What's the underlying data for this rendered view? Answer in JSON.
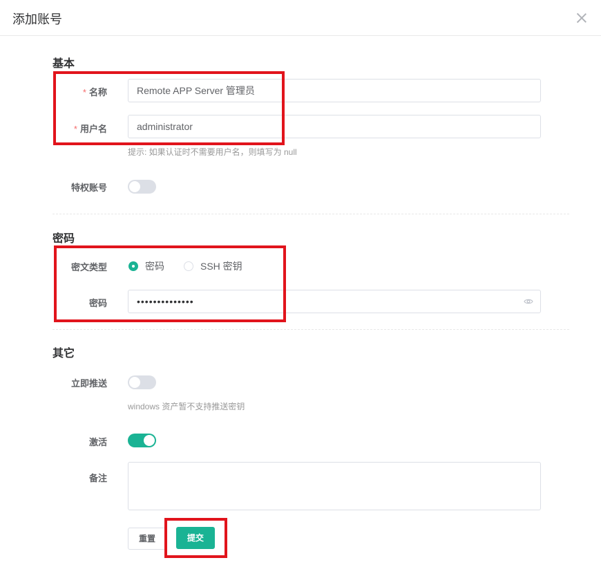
{
  "dialog": {
    "title": "添加账号"
  },
  "sections": {
    "basic": "基本",
    "password": "密码",
    "other": "其它"
  },
  "fields": {
    "name": {
      "label": "名称",
      "required_mark": "*",
      "value": "Remote APP Server 管理员"
    },
    "username": {
      "label": "用户名",
      "required_mark": "*",
      "value": "administrator",
      "hint": "提示: 如果认证时不需要用户名，则填写为 null"
    },
    "privileged": {
      "label": "特权账号",
      "on": false
    },
    "secret_type": {
      "label": "密文类型",
      "options": [
        "密码",
        "SSH 密钥"
      ],
      "selected": "密码"
    },
    "secret": {
      "label": "密码",
      "value": "••••••••••••••"
    },
    "push_now": {
      "label": "立即推送",
      "on": false,
      "hint": "windows 资产暂不支持推送密钥"
    },
    "active": {
      "label": "激活",
      "on": true
    },
    "comment": {
      "label": "备注",
      "value": ""
    }
  },
  "buttons": {
    "reset": "重置",
    "submit": "提交"
  },
  "colors": {
    "accent": "#1ab394",
    "required": "#f56c6c",
    "highlight_box": "#e1141c"
  }
}
